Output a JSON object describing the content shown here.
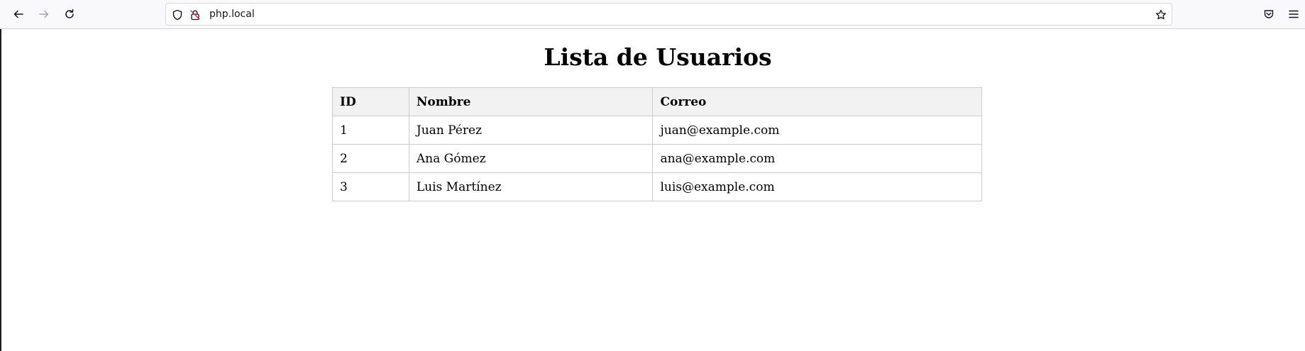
{
  "browser": {
    "url": "php.local",
    "icons": {
      "back": "arrow-left-icon",
      "forward": "arrow-right-icon",
      "reload": "reload-icon",
      "tracking_protection": "shield-icon",
      "insecure": "insecure-lock-icon",
      "bookmark": "star-icon",
      "pocket": "pocket-icon",
      "menu": "hamburger-menu-icon"
    }
  },
  "page": {
    "title": "Lista de Usuarios",
    "table": {
      "headers": [
        "ID",
        "Nombre",
        "Correo"
      ],
      "rows": [
        [
          "1",
          "Juan Pérez",
          "juan@example.com"
        ],
        [
          "2",
          "Ana Gómez",
          "ana@example.com"
        ],
        [
          "3",
          "Luis Martínez",
          "luis@example.com"
        ]
      ]
    }
  }
}
